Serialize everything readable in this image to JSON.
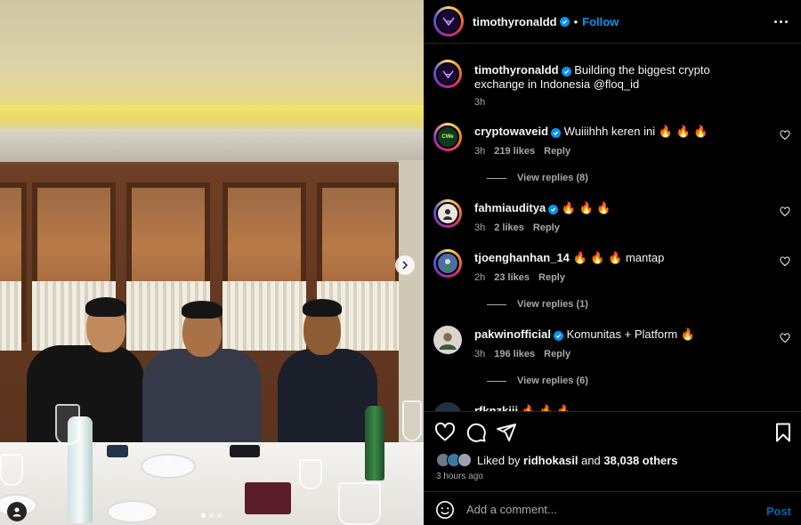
{
  "post": {
    "author": "timothyronaldd",
    "follow_label": "Follow",
    "separator": "•"
  },
  "caption": {
    "username": "timothyronaldd",
    "text": "Building the biggest crypto exchange in Indonesia @floq_id",
    "time": "3h"
  },
  "comments": [
    {
      "username": "cryptowaveid",
      "text": "Wuiiihhh keren ini",
      "emoji": "🔥 🔥 🔥",
      "verified": true,
      "time": "3h",
      "likes": "219 likes",
      "reply": "Reply",
      "replies": "View replies (8)",
      "avatar_label": "CWe"
    },
    {
      "username": "fahmiauditya",
      "text": "",
      "emoji": "🔥 🔥 🔥",
      "verified": true,
      "time": "3h",
      "likes": "2 likes",
      "reply": "Reply"
    },
    {
      "username": "tjoenghanhan_14",
      "text": "mantap",
      "emoji": "🔥 🔥 🔥",
      "verified": false,
      "time": "2h",
      "likes": "23 likes",
      "reply": "Reply",
      "replies": "View replies (1)"
    },
    {
      "username": "pakwinofficial",
      "text": "Komunitas + Platform",
      "emoji": "🔥",
      "verified": true,
      "time": "3h",
      "likes": "196 likes",
      "reply": "Reply",
      "replies": "View replies (6)"
    },
    {
      "username": "rfknzkiii",
      "emoji": "🔥 🔥 🔥"
    }
  ],
  "likes": {
    "prefix": "Liked by",
    "user": "ridhokasil",
    "middle": "and",
    "count": "38,038 others"
  },
  "time_ago": "3 hours ago",
  "add_comment": {
    "placeholder": "Add a comment...",
    "post_label": "Post"
  },
  "carousel": {
    "total": 3,
    "active_index": 0
  },
  "colors": {
    "accent": "#0095f6",
    "muted": "#a8a8a8",
    "background": "#000000"
  },
  "icons": [
    "verified-badge-icon",
    "more-icon",
    "heart-icon",
    "comment-icon",
    "share-icon",
    "bookmark-icon",
    "emoji-icon",
    "next-arrow-icon",
    "tag-user-icon"
  ]
}
